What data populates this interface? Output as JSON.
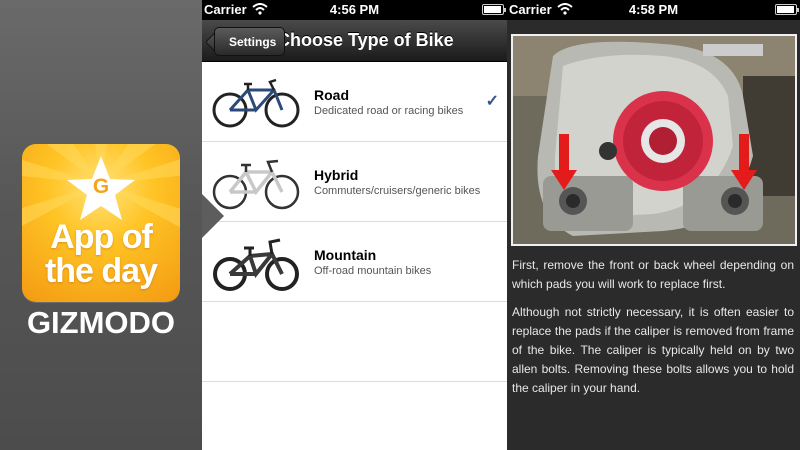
{
  "promo": {
    "badge_letter": "G",
    "headline": "App of the day",
    "brand": "GIZMODO",
    "colors": {
      "badge_light": "#ffe27a",
      "badge_mid": "#ffc425",
      "badge_dark": "#f39a12"
    }
  },
  "screen1": {
    "status": {
      "carrier": "Carrier",
      "time": "4:56 PM"
    },
    "nav": {
      "back_label": "Settings",
      "title": "Choose Type of Bike"
    },
    "bikes": [
      {
        "name": "Road",
        "description": "Dedicated road or racing bikes",
        "selected": true,
        "check": "✓"
      },
      {
        "name": "Hybrid",
        "description": "Commuters/cruisers/generic bikes",
        "selected": false
      },
      {
        "name": "Mountain",
        "description": "Off-road mountain bikes",
        "selected": false
      }
    ]
  },
  "screen2": {
    "status": {
      "carrier": "Carrier",
      "time": "4:58 PM"
    },
    "paragraphs": [
      "First, remove the front or back wheel depending on which pads you will work to replace first.",
      "Although not strictly necessary, it is often easier to replace the pads if the caliper is removed from frame of the bike. The caliper is typically held on by two allen bolts. Removing these bolts allows you to hold the caliper in your hand."
    ]
  }
}
